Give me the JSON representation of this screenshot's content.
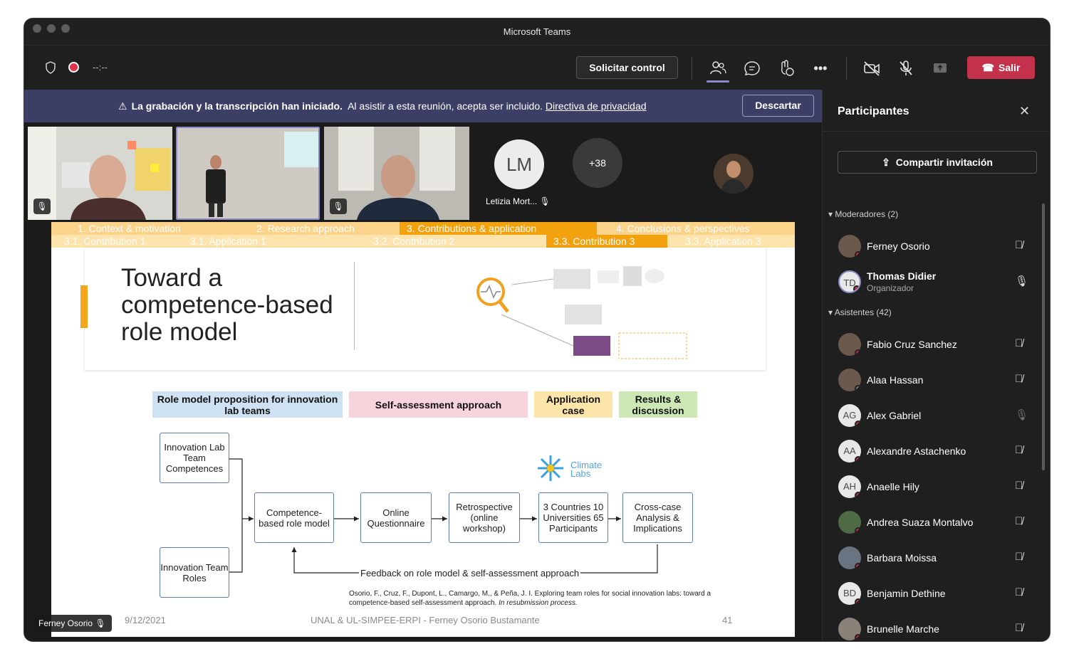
{
  "window": {
    "title": "Microsoft Teams"
  },
  "toolbar": {
    "timer": "--:--",
    "request_control": "Solicitar control",
    "leave": "Salir"
  },
  "banner": {
    "bold": "La grabación y la transcripción han iniciado.",
    "text": "Al asistir a esta reunión, acepta ser incluido.",
    "link": "Directiva de privacidad",
    "dismiss": "Descartar"
  },
  "gallery": {
    "initials": "LM",
    "name": "Letizia Mort...",
    "more": "+38"
  },
  "slide": {
    "nav_top": [
      "1. Context & motivation",
      "2. Research approach",
      "3. Contributions & application",
      "4. Conclusions & perspectives"
    ],
    "nav_bottom": [
      "3.1. Contribution 1",
      "3.1. Application 1",
      "3.2. Contribution 2",
      "3.3. Contribution 3",
      "3.3. Application 3"
    ],
    "title": "Toward a competence-based role model",
    "categories": [
      {
        "label": "Role model proposition for innovation lab teams",
        "color": "#cfe2f3"
      },
      {
        "label": "Self-assessment approach",
        "color": "#f7d4dc"
      },
      {
        "label": "Application case",
        "color": "#fce5a8"
      },
      {
        "label": "Results & discussion",
        "color": "#cce8b5"
      }
    ],
    "boxes": {
      "competences": "Innovation Lab Team Competences",
      "roles": "Innovation Team Roles",
      "model": "Competence-based role model",
      "questionnaire": "Online Questionnaire",
      "retro": "Retrospective (online workshop)",
      "countries": "3 Countries 10 Universities 65 Participants",
      "cross": "Cross-case Analysis & Implications"
    },
    "feedback": "Feedback on role model & self-assessment approach",
    "logo": "Climate Labs",
    "reference": "Osorio, F., Cruz, F., Dupont, L., Camargo, M., & Peña, J. I. Exploring team roles for social innovation labs: toward a competence-based self-assessment approach.",
    "reference_italic": "In resubmission process.",
    "footer_date": "9/12/2021",
    "footer_center": "UNAL & UL-SIMPEE-ERPI - Ferney Osorio Bustamante",
    "footer_page": "41"
  },
  "presenter_tag": "Ferney Osorio",
  "panel": {
    "title": "Participantes",
    "share": "Compartir invitación",
    "moderators_label": "Moderadores (2)",
    "attendees_label": "Asistentes (42)",
    "moderators": [
      {
        "name": "Ferney Osorio",
        "initials": "",
        "role": ""
      },
      {
        "name": "Thomas Didier",
        "initials": "TD",
        "role": "Organizador"
      }
    ],
    "attendees": [
      {
        "name": "Fabio Cruz Sanchez",
        "initials": ""
      },
      {
        "name": "Alaa Hassan",
        "initials": ""
      },
      {
        "name": "Alex Gabriel",
        "initials": "AG"
      },
      {
        "name": "Alexandre Astachenko",
        "initials": "AA"
      },
      {
        "name": "Anaelle Hily",
        "initials": "AH"
      },
      {
        "name": "Andrea Suaza Montalvo",
        "initials": ""
      },
      {
        "name": "Barbara Moissa",
        "initials": ""
      },
      {
        "name": "Benjamin Dethine",
        "initials": "BD"
      },
      {
        "name": "Brunelle Marche",
        "initials": ""
      }
    ]
  }
}
